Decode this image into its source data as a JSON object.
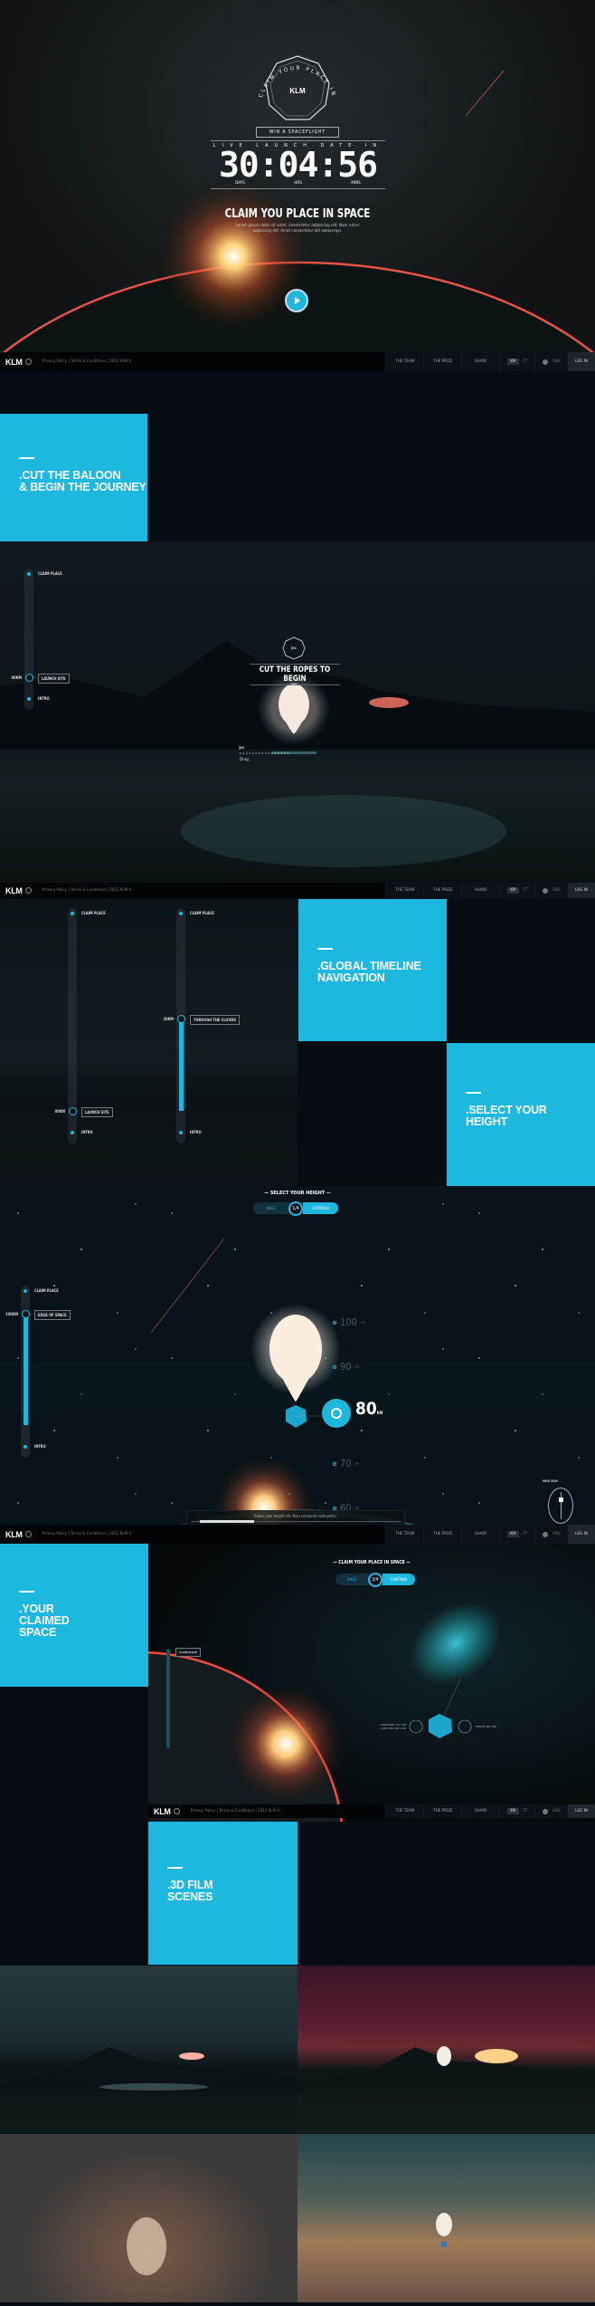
{
  "colors": {
    "accent": "#1db8e0",
    "background": "#060c12"
  },
  "footer": {
    "logo": "KLM",
    "links": "Privacy Policy  |  Terms & Conditions  |  2012 KLM ©",
    "nav": [
      "THE TEAM",
      "THE PRIZE",
      "SHARE"
    ],
    "units": [
      "KM",
      "FT"
    ],
    "language": "ENG",
    "login": "LOG IN",
    "globe_icon": "globe-icon"
  },
  "hero": {
    "badge_ring": "CLAIM YOUR PLACE IN SPACE",
    "badge_logo": "KLM",
    "win": "WIN A SPACEFLIGHT",
    "countdown_label": "LIVE LAUNCH DATE IN",
    "countdown": "30:04:56",
    "units": [
      "DAYS",
      "HRS",
      "MINS"
    ],
    "title": "CLAIM YOU PLACE IN SPACE",
    "body": "Lorem ipsum dolor sit amet, consectetur adipiscing elit. Nam rutrur adipiscing elit. Amet consectetur elit adepiscign.",
    "play_icon": "play-icon"
  },
  "sections": {
    "cut": ".CUT THE BALOON\n& BEGIN THE JOURNEY",
    "timeline": ".GLOBAL TIMELINE\nNAVIGATION",
    "height": ".SELECT YOUR\nHEIGHT",
    "claimed": ".YOUR\nCLAIMED\nSPACE",
    "film": ".3D FILM\nSCENES"
  },
  "scene_cut": {
    "title": "CUT THE ROPES TO BEGIN",
    "drag": "Drag",
    "timeline": {
      "top": "CLAIM PLACE",
      "bottom": "INTRO",
      "tag": "LAUNCH SITE",
      "km": "00KM"
    }
  },
  "timeline_demo": [
    {
      "top": "CLAIM PLACE",
      "bottom": "INTRO",
      "tag": "LAUNCH SITE",
      "km": "00KM",
      "progress": 0
    },
    {
      "top": "CLAIM PLACE",
      "bottom": "INTRO",
      "tag": "THROUGH THE CLOUDS",
      "km": "20KM",
      "progress": 0.5
    }
  ],
  "scene_height": {
    "title": "SELECT YOUR HEIGHT",
    "back": "BACK",
    "step": "1/4",
    "continue": "CONTINUE",
    "timeline": {
      "top": "CLAIM PLACE",
      "bottom": "INTRO",
      "tag": "EDGE OF SPACE",
      "km": "100KM"
    },
    "heights": [
      "100",
      "90",
      "80",
      "70",
      "60"
    ],
    "selected": "80",
    "unit": "KM",
    "audio_text": "\"Select your height elit. Nam comporta nolle porta...",
    "mini_map": "MINI MAP"
  },
  "scene_claim": {
    "title": "CLAIM YOUR PLACE IN SPACE",
    "back": "BACK",
    "step": "3/4",
    "continue": "CONTINUE",
    "longitude": "LONGITUDE: 50.7 KM",
    "latitude": "LATITUDE: 203.3 KM",
    "height": "HEIGHT: 80.7 KM",
    "claim_tag": "CLAIM PLACE"
  }
}
